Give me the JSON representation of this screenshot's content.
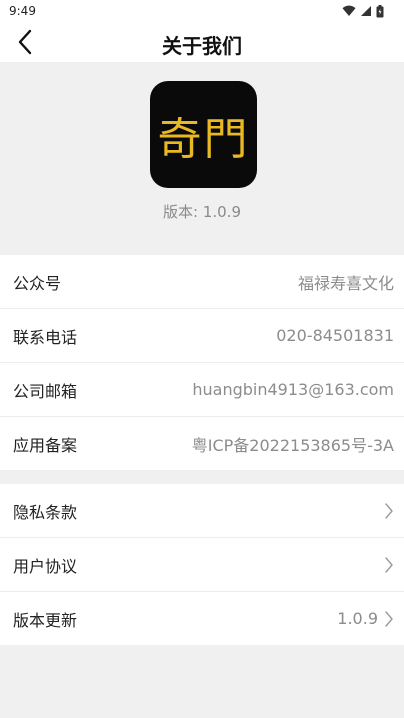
{
  "status": {
    "time": "9:49",
    "icons": [
      "wifi-icon",
      "signal-icon",
      "battery-icon"
    ]
  },
  "nav": {
    "back_icon": "back-arrow-icon",
    "title": "关于我们"
  },
  "app": {
    "logo_text": "奇門",
    "logo_colors": {
      "background": "#0a0a0a",
      "text": "#e8b923"
    },
    "version_label": "版本: 1.0.9"
  },
  "info_rows": [
    {
      "label": "公众号",
      "value": "福禄寿喜文化"
    },
    {
      "label": "联系电话",
      "value": "020-84501831"
    },
    {
      "label": "公司邮箱",
      "value": "huangbin4913@163.com"
    },
    {
      "label": "应用备案",
      "value": "粤ICP备2022153865号-3A"
    }
  ],
  "link_rows": [
    {
      "label": "隐私条款",
      "value": "",
      "icon": "chevron-right-icon"
    },
    {
      "label": "用户协议",
      "value": "",
      "icon": "chevron-right-icon"
    },
    {
      "label": "版本更新",
      "value": "1.0.9",
      "icon": "chevron-right-icon"
    }
  ],
  "colors": {
    "page_background": "#f0f0f0",
    "card_background": "#ffffff",
    "secondary_text": "#8c8c8c"
  }
}
